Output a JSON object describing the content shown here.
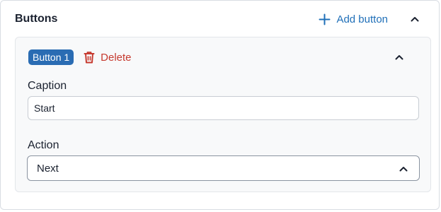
{
  "section": {
    "title": "Buttons",
    "add_label": "Add button",
    "collapse_icon": "chevron-up-icon"
  },
  "button_card": {
    "badge": "Button 1",
    "delete_label": "Delete",
    "delete_icon": "trash-icon",
    "caption": {
      "label": "Caption",
      "value": "Start"
    },
    "action": {
      "label": "Action",
      "selected": "Next"
    }
  },
  "colors": {
    "accent": "#1f6fb8",
    "badge_bg": "#2a6cb3",
    "danger": "#c63a2f"
  }
}
